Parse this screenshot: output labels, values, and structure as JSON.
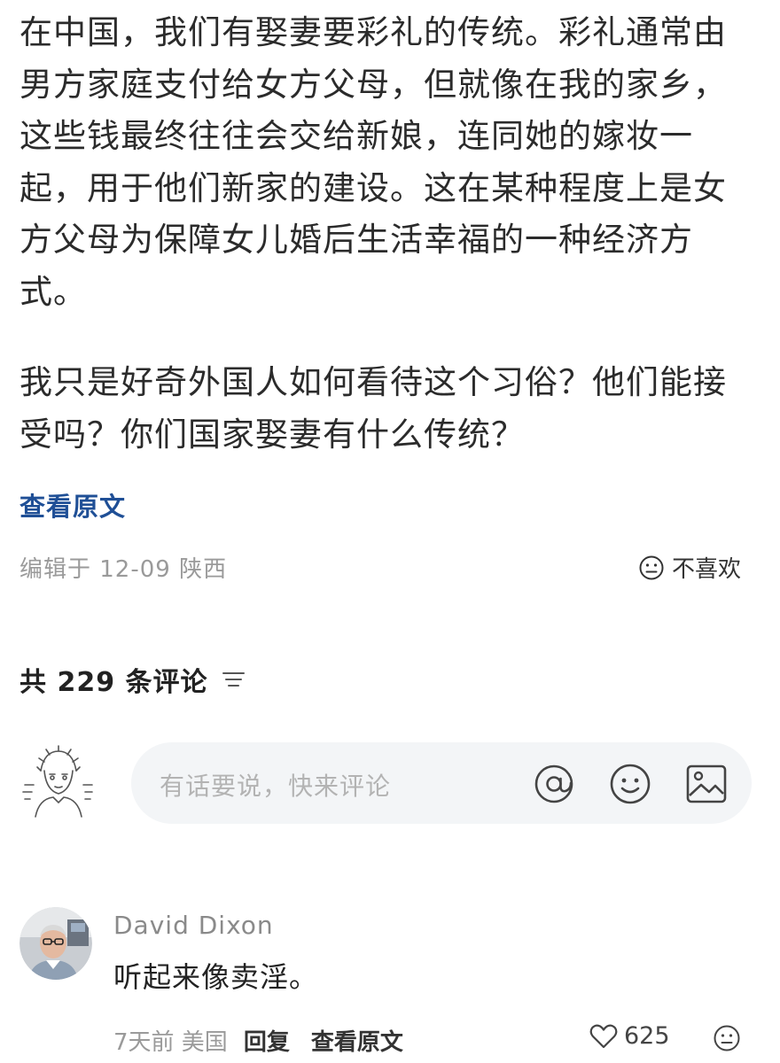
{
  "post": {
    "lines": [
      "在中国，我们有娶妻要彩礼的传统。彩礼通常由",
      "男方家庭支付给女方父母，但就像在我的家乡，",
      "这些钱最终往往会交给新娘，连同她的嫁妆一",
      "起，用于他们新家的建设。这在某种程度上是女",
      "方父母为保障女儿婚后生活幸福的一种经济方",
      "式。"
    ],
    "question_lines": [
      "我只是好奇外国人如何看待这个习俗？他们能接",
      "受吗？你们国家娶妻有什么传统？"
    ],
    "view_original": "查看原文",
    "meta": "编辑于 12-09 陕西",
    "dislike_label": "不喜欢"
  },
  "comments_section": {
    "heading": "共 229 条评论",
    "input_placeholder": "有话要说，快来评论",
    "icons": [
      "at-icon",
      "emoji-icon",
      "image-icon",
      "sort-icon"
    ]
  },
  "comments": [
    {
      "author": "David Dixon",
      "text": "听起来像卖淫。",
      "time": "7天前 美国",
      "reply_label": "回复",
      "view_original_label": "查看原文",
      "likes": "625"
    }
  ],
  "colors": {
    "link_blue": "#1f4f96",
    "muted_gray": "#9a9a9a",
    "input_bg": "#f3f5f7"
  }
}
